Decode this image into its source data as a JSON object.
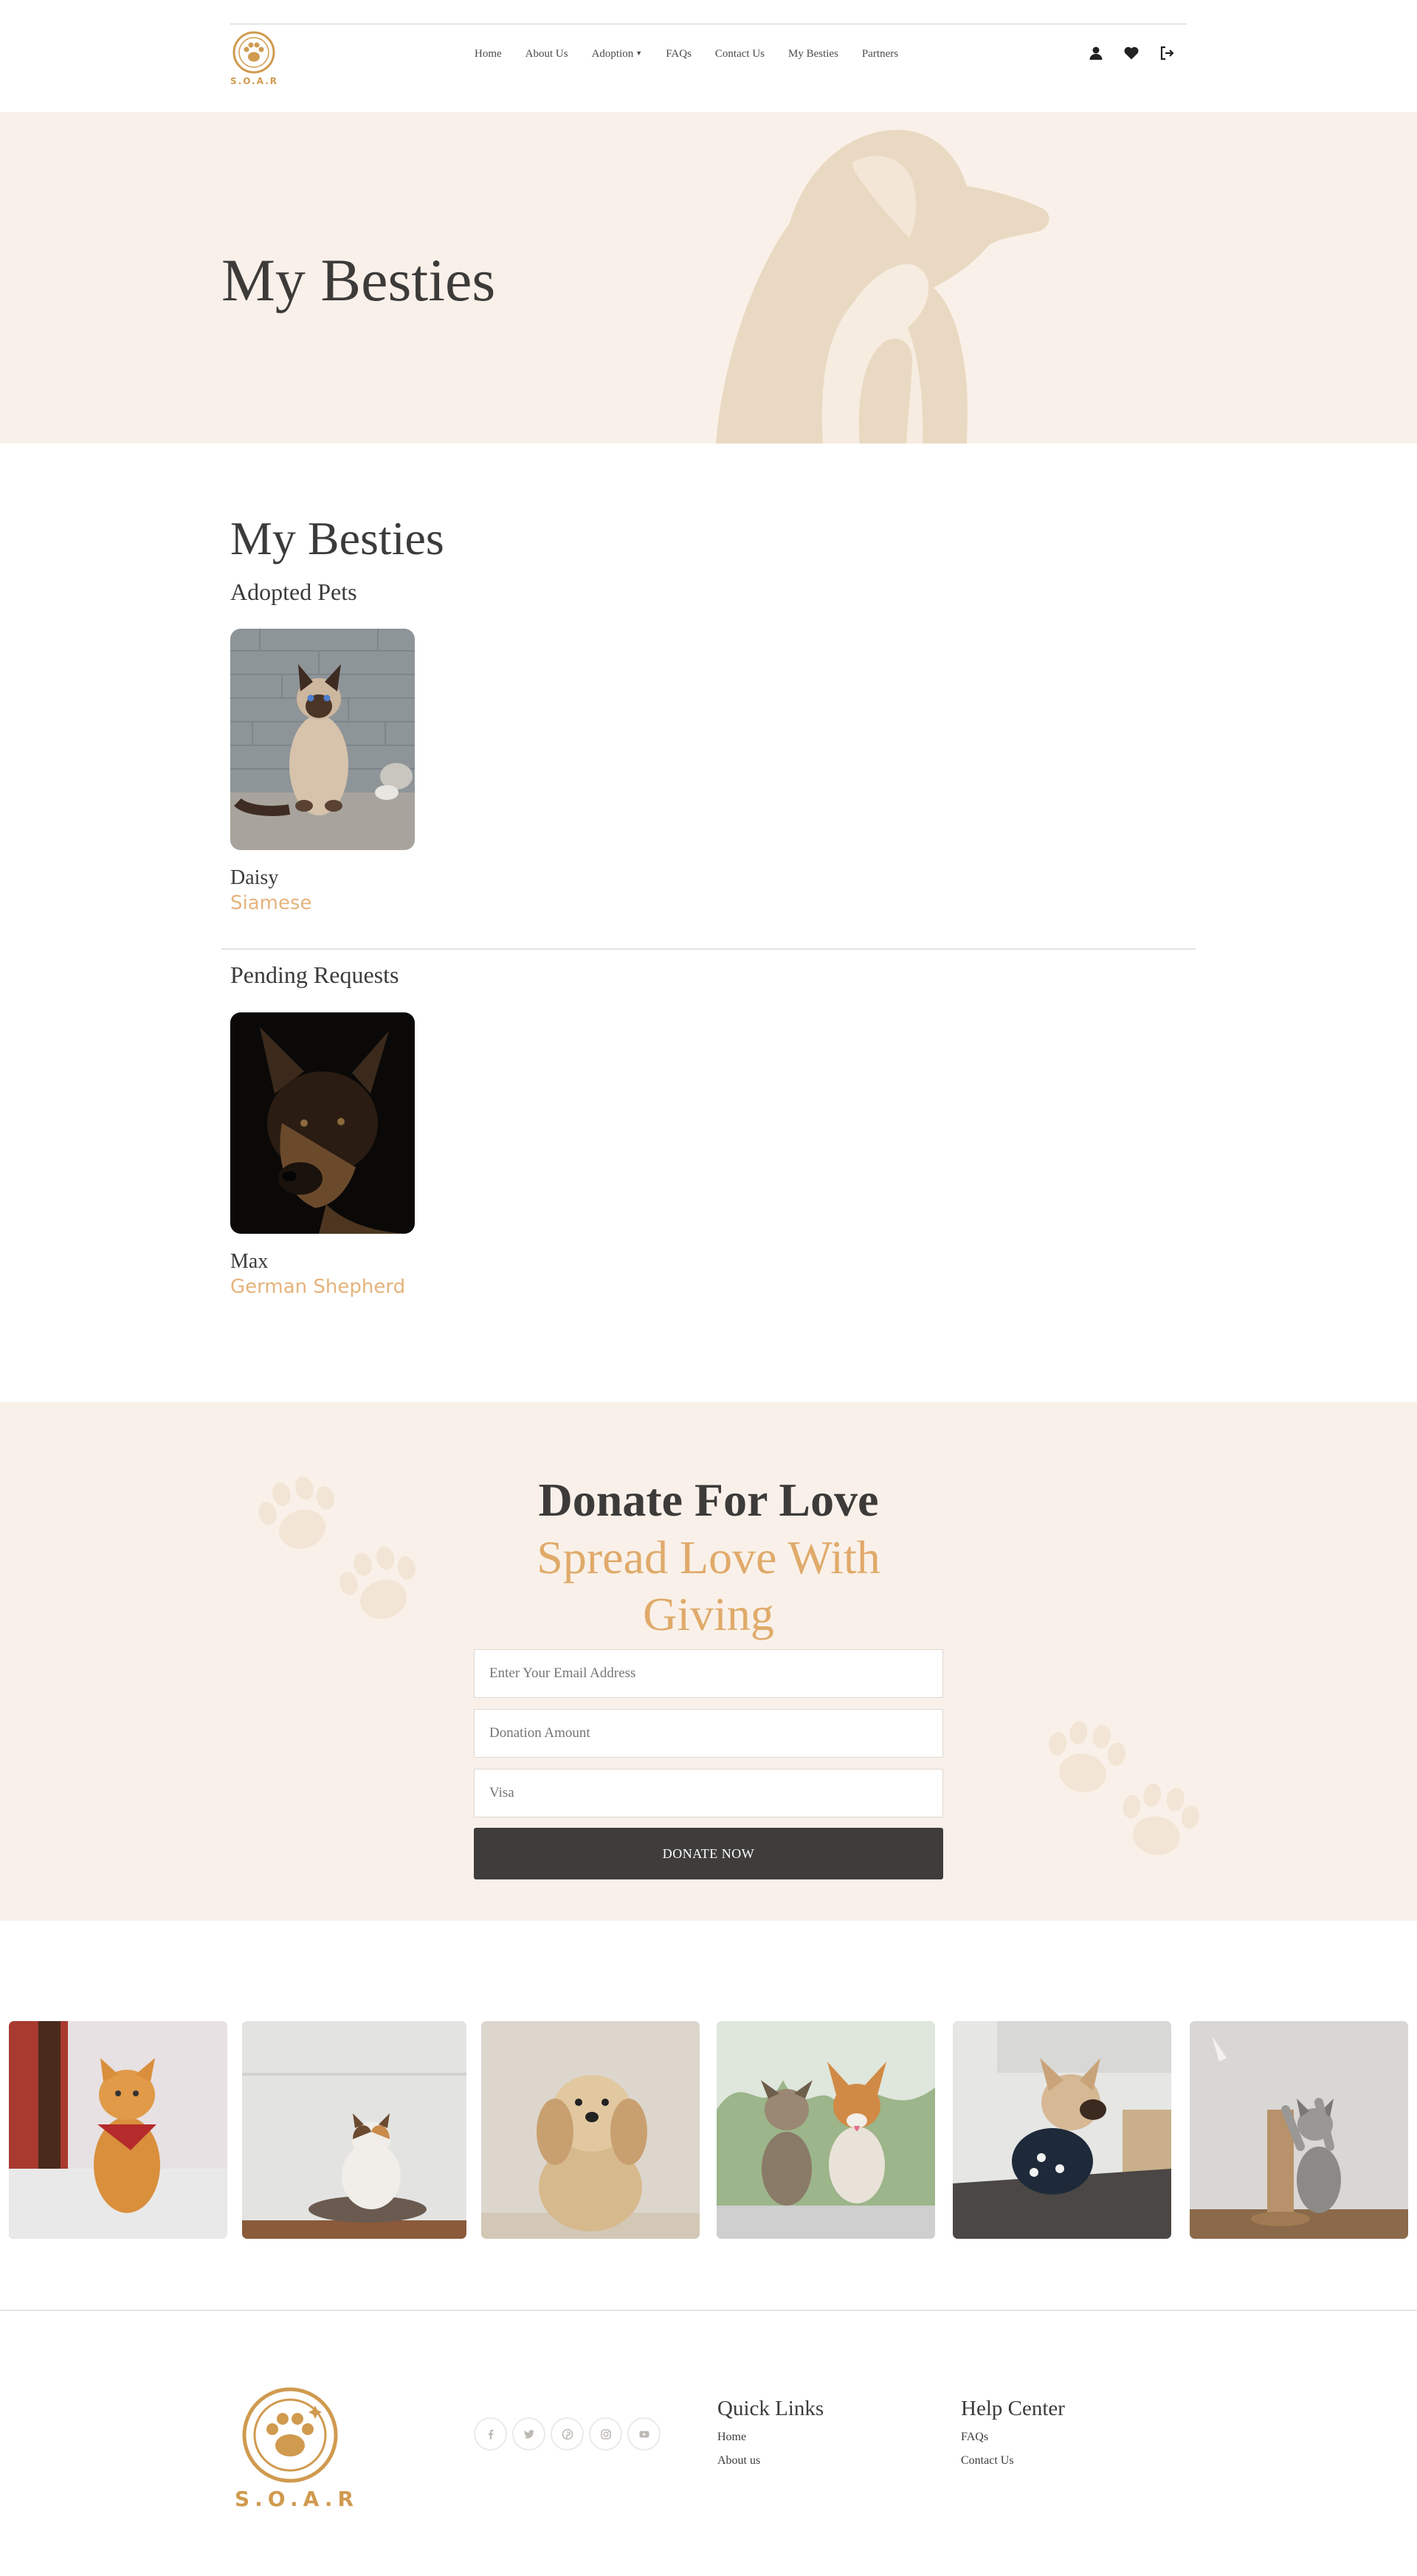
{
  "header": {
    "logo_text": "S.O.A.R",
    "nav": [
      "Home",
      "About Us",
      "Adoption",
      "FAQs",
      "Contact Us",
      "My Besties",
      "Partners"
    ],
    "icons": [
      "user-icon",
      "heart-icon",
      "logout-icon"
    ]
  },
  "hero": {
    "title": "My Besties"
  },
  "besties": {
    "title": "My Besties",
    "adopted_heading": "Adopted Pets",
    "adopted": [
      {
        "name": "Daisy",
        "breed": "Siamese"
      }
    ],
    "pending_heading": "Pending Requests",
    "pending": [
      {
        "name": "Max",
        "breed": "German Shepherd"
      }
    ]
  },
  "donate": {
    "title": "Donate For Love",
    "subtitle": "Spread Love With Giving",
    "email_placeholder": "Enter Your Email Address",
    "amount_placeholder": "Donation Amount",
    "card_placeholder": "Visa",
    "button": "DONATE NOW"
  },
  "footer": {
    "logo_text": "S.O.A.R",
    "socials": [
      "facebook-icon",
      "twitter-icon",
      "pinterest-icon",
      "instagram-icon",
      "youtube-icon"
    ],
    "quick_links": {
      "title": "Quick Links",
      "links": [
        "Home",
        "About us"
      ]
    },
    "help_center": {
      "title": "Help Center",
      "links": [
        "FAQs",
        "Contact Us"
      ]
    }
  },
  "colors": {
    "accent": "#e0aa6a",
    "cream": "#f9f1e9",
    "dark": "#3e3d3c"
  }
}
